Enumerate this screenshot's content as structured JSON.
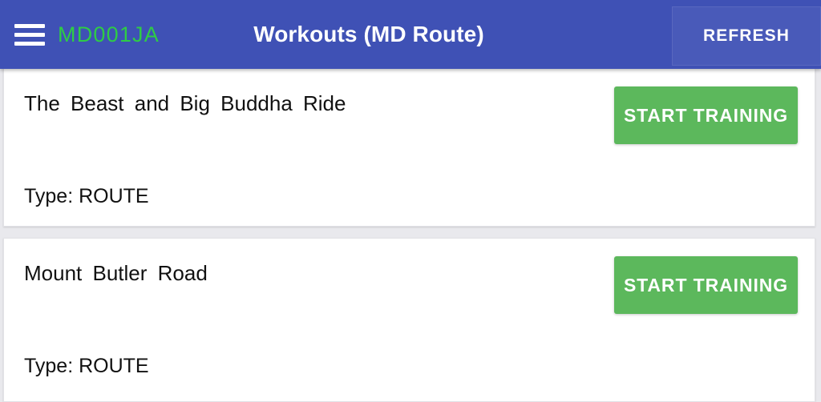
{
  "appbar": {
    "menu_icon": "hamburger-menu-icon",
    "device_id": "MD001JA",
    "title": "Workouts (MD Route)",
    "refresh_label": "REFRESH",
    "background_color": "#3f51b5",
    "device_id_color": "#2ecc45"
  },
  "workouts": [
    {
      "name": "The Beast and Big Buddha Ride",
      "type_label": "Type: ROUTE",
      "action_label": "START TRAINING"
    },
    {
      "name": "Mount Butler Road",
      "type_label": "Type: ROUTE",
      "action_label": "START TRAINING"
    }
  ],
  "colors": {
    "accent_green": "#5cb85c",
    "card_background": "#ffffff",
    "list_background": "#e9e9ed"
  }
}
